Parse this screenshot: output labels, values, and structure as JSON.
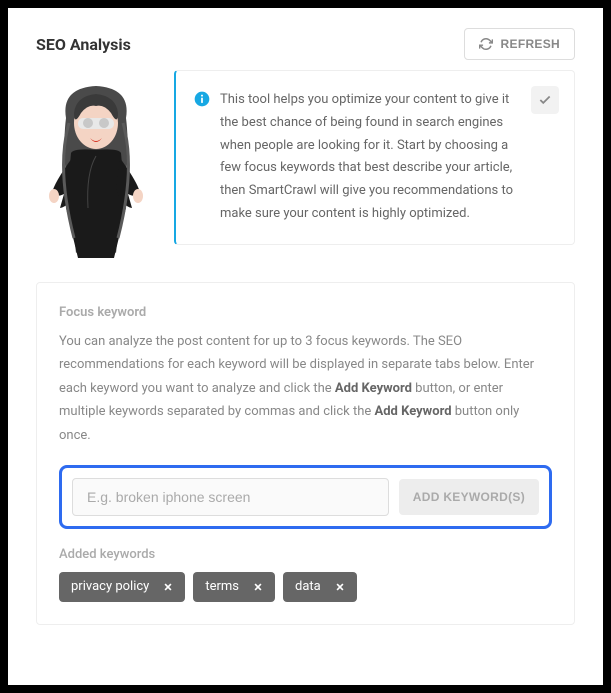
{
  "header": {
    "title": "SEO Analysis",
    "refresh_label": "REFRESH"
  },
  "info": {
    "text": "This tool helps you optimize your content to give it the best chance of being found in search engines when people are looking for it. Start by choosing a few focus keywords that best describe your article, then SmartCrawl will give you recommendations to make sure your content is highly optimized."
  },
  "focus": {
    "label": "Focus keyword",
    "desc_1": "You can analyze the post content for up to 3 focus keywords. The SEO recommendations for each keyword will be displayed in separate tabs below. Enter each keyword you want to analyze and click the ",
    "bold_1": "Add Keyword",
    "desc_2": " button, or enter multiple keywords separated by commas and click the ",
    "bold_2": "Add Keyword",
    "desc_3": " button only once.",
    "placeholder": "E.g. broken iphone screen",
    "add_label": "ADD KEYWORD(S)"
  },
  "added": {
    "label": "Added keywords",
    "tags": [
      "privacy policy",
      "terms",
      "data"
    ]
  }
}
